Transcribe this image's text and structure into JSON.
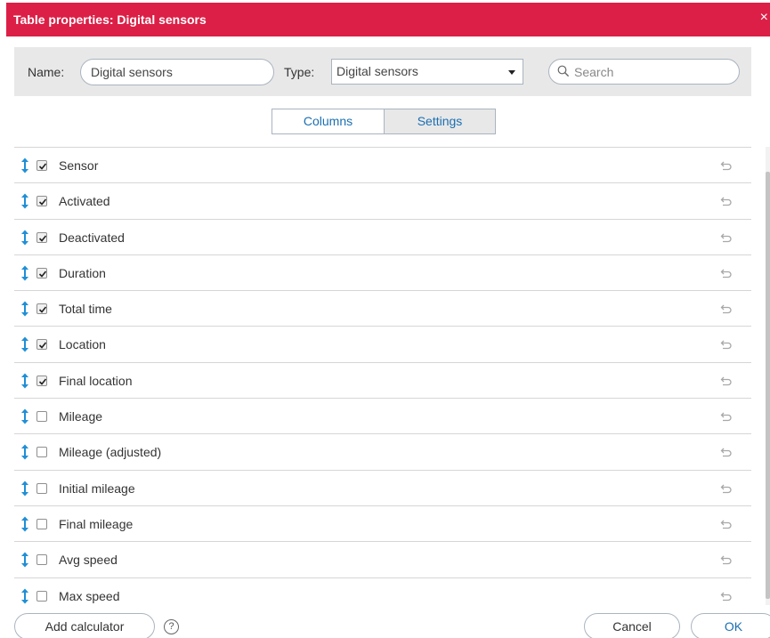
{
  "dialog": {
    "title": "Table properties: Digital sensors",
    "close_glyph": "×"
  },
  "toolbar": {
    "name_label": "Name:",
    "name_value": "Digital sensors",
    "type_label": "Type:",
    "type_value": "Digital sensors",
    "search_placeholder": "Search"
  },
  "tabs": {
    "columns": "Columns",
    "settings": "Settings",
    "active": "Settings"
  },
  "rows": [
    {
      "label": "Sensor",
      "checked": true
    },
    {
      "label": "Activated",
      "checked": true
    },
    {
      "label": "Deactivated",
      "checked": true
    },
    {
      "label": "Duration",
      "checked": true
    },
    {
      "label": "Total time",
      "checked": true
    },
    {
      "label": "Location",
      "checked": true
    },
    {
      "label": "Final location",
      "checked": true
    },
    {
      "label": "Mileage",
      "checked": false
    },
    {
      "label": "Mileage (adjusted)",
      "checked": false
    },
    {
      "label": "Initial mileage",
      "checked": false
    },
    {
      "label": "Final mileage",
      "checked": false
    },
    {
      "label": "Avg speed",
      "checked": false
    },
    {
      "label": "Max speed",
      "checked": false
    }
  ],
  "footer": {
    "add_calculator": "Add calculator",
    "help_glyph": "?",
    "cancel": "Cancel",
    "ok": "OK"
  },
  "colors": {
    "title_bar": "#dc1f46",
    "accent": "#1b6fb2",
    "handle": "#1f8fd6"
  },
  "icons": {
    "row_handle": "move-vertical-icon",
    "row_reset": "undo-icon",
    "search": "search-icon"
  }
}
